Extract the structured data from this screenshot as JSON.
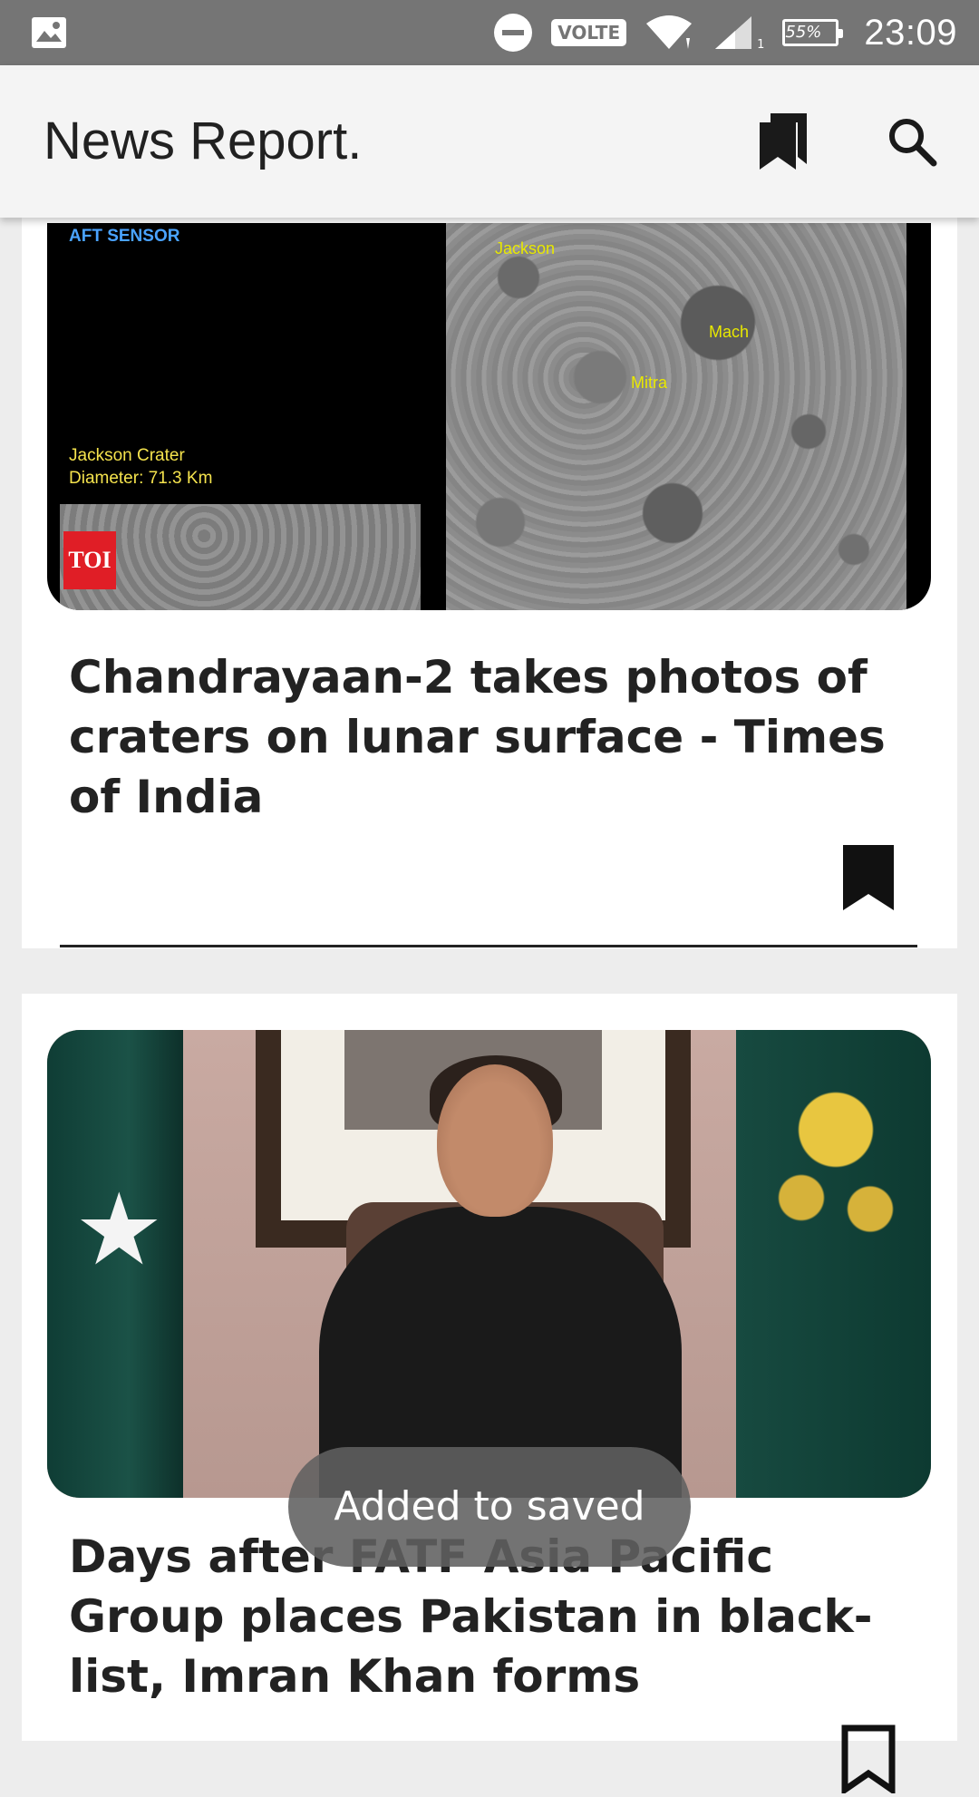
{
  "status_bar": {
    "battery": "55%",
    "network_type": "VOLTE",
    "sim_indicator": "1",
    "time": "23:09"
  },
  "app_bar": {
    "title": "News Report."
  },
  "articles": [
    {
      "image": {
        "sensor_label": "AFT SENSOR",
        "crater_labels": [
          "Jackson",
          "Mach",
          "Mitra"
        ],
        "caption_line1": "Jackson Crater",
        "caption_line2": "Diameter: 71.3 Km",
        "badge": "TOI"
      },
      "headline": "Chandrayaan-2 takes photos of craters on lunar surface - Times of India"
    },
    {
      "headline": "Days after FATF Asia Pacific Group places Pakistan in black-list, Imran Khan forms committe..."
    }
  ],
  "toast": {
    "message": "Added to saved"
  },
  "colors": {
    "status_bar": "#757575",
    "app_bar": "#f4f4f4",
    "feed_background": "#ededed",
    "toast": "#606060",
    "toi_red": "#e01e26"
  },
  "icons": [
    "image-notification-icon",
    "do-not-disturb-icon",
    "wifi-icon",
    "signal-icon",
    "battery-icon",
    "saved-bookmarks-icon",
    "search-icon",
    "bookmark-icon"
  ]
}
